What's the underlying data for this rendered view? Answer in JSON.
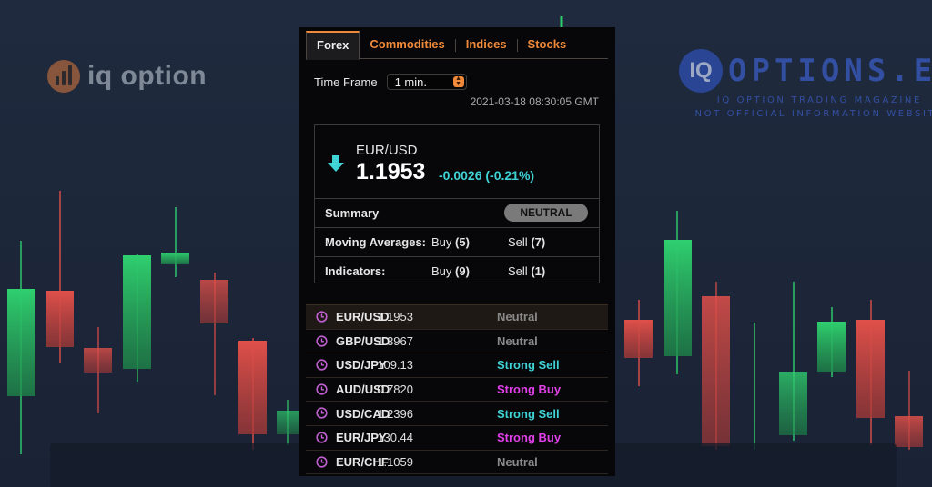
{
  "background": {
    "left_logo": {
      "text": "iq option"
    },
    "right_logo": {
      "mark": "IQ",
      "text": "OPTIONS.EU",
      "sub1": "IQ OPTION TRADING MAGAZINE",
      "sub2": "NOT OFFICIAL INFORMATION WEBSITE"
    }
  },
  "tabs": [
    {
      "label": "Forex",
      "active": true
    },
    {
      "label": "Commodities",
      "active": false
    },
    {
      "label": "Indices",
      "active": false
    },
    {
      "label": "Stocks",
      "active": false
    }
  ],
  "timeframe": {
    "label": "Time Frame",
    "value": "1 min."
  },
  "timestamp": "2021-03-18 08:30:05 GMT",
  "quote": {
    "symbol": "EUR/USD",
    "price": "1.1953",
    "change": "-0.0026 (-0.21%)",
    "direction_icon": "arrow-down-icon",
    "summary_label": "Summary",
    "summary_value": "NEUTRAL",
    "moving_averages": {
      "label": "Moving Averages:",
      "buy_label": "Buy",
      "buy_count": "(5)",
      "sell_label": "Sell",
      "sell_count": "(7)"
    },
    "indicators": {
      "label": "Indicators:",
      "buy_label": "Buy",
      "buy_count": "(9)",
      "sell_label": "Sell",
      "sell_count": "(1)"
    }
  },
  "pairs": [
    {
      "symbol": "EUR/USD",
      "price": "1.1953",
      "signal": "Neutral",
      "color": "#8a8a8a"
    },
    {
      "symbol": "GBP/USD",
      "price": "1.3967",
      "signal": "Neutral",
      "color": "#8a8a8a"
    },
    {
      "symbol": "USD/JPY",
      "price": "109.13",
      "signal": "Strong Sell",
      "color": "#3fd3d6"
    },
    {
      "symbol": "AUD/USD",
      "price": "0.7820",
      "signal": "Strong Buy",
      "color": "#e040e8"
    },
    {
      "symbol": "USD/CAD",
      "price": "1.2396",
      "signal": "Strong Sell",
      "color": "#3fd3d6"
    },
    {
      "symbol": "EUR/JPY",
      "price": "130.44",
      "signal": "Strong Buy",
      "color": "#e040e8"
    },
    {
      "symbol": "EUR/CHF",
      "price": "1.1059",
      "signal": "Neutral",
      "color": "#8a8a8a"
    }
  ],
  "colors": {
    "accent_orange": "#f08a3a",
    "sell_cyan": "#3fd3d6",
    "buy_magenta": "#e040e8",
    "neutral_gray": "#8a8a8a",
    "candle_green": "#2fcf6f",
    "candle_red": "#e0504a"
  }
}
